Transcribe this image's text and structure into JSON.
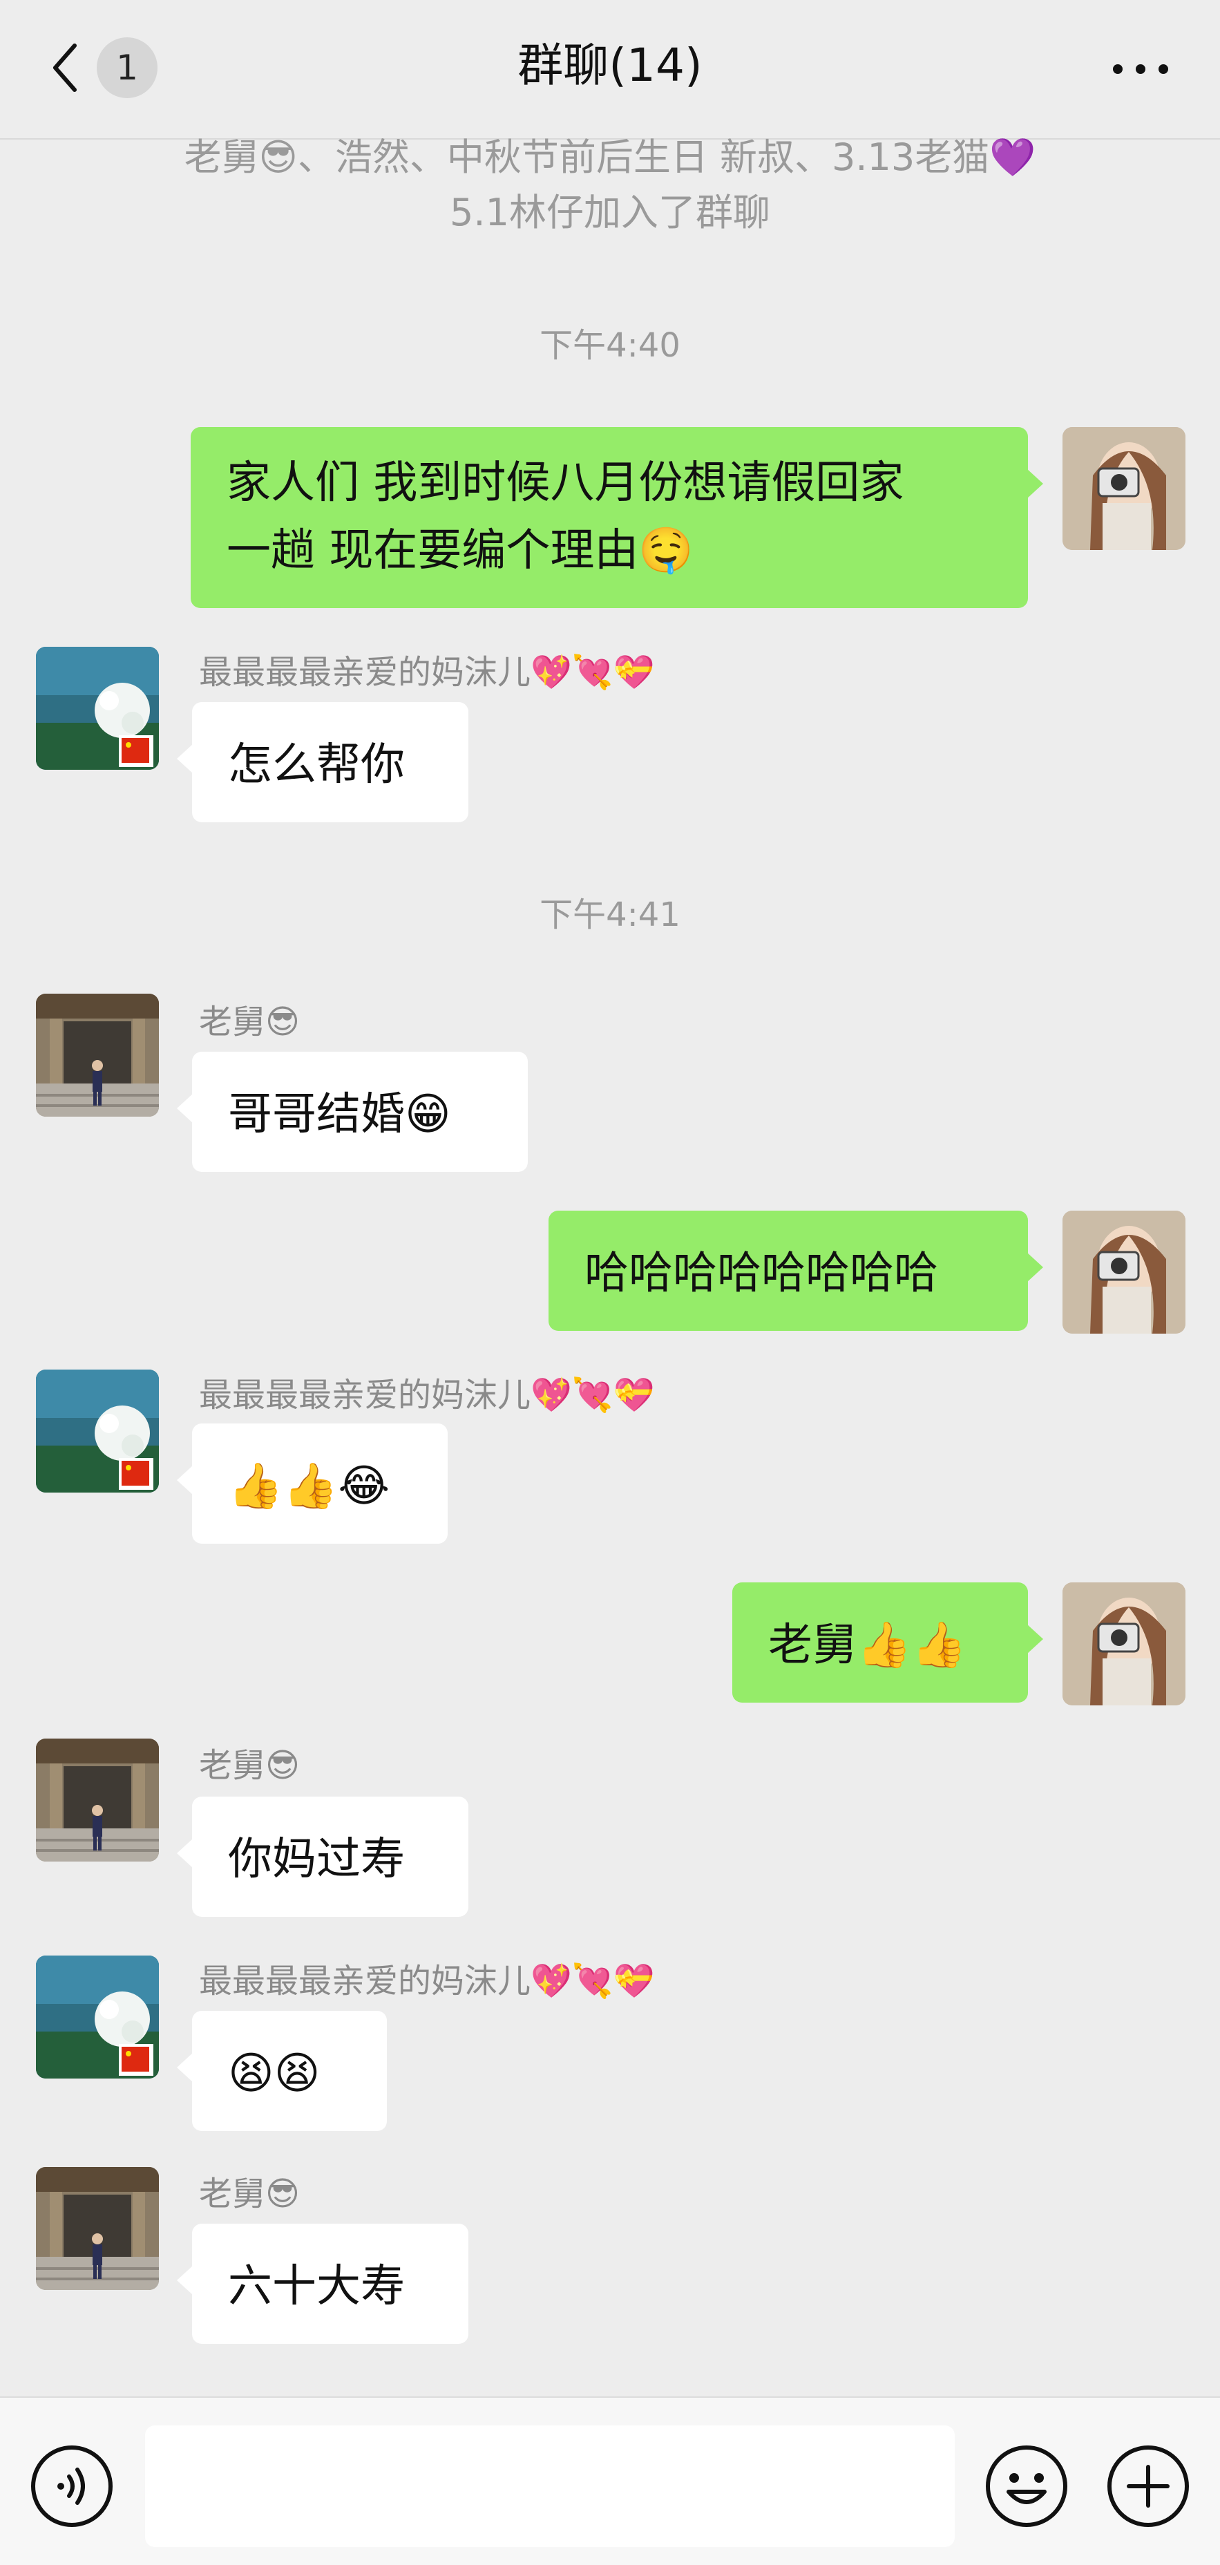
{
  "header": {
    "back_count": "1",
    "title": "群聊(14)"
  },
  "system_notice": {
    "line1": "老舅😎、浩然、中秋节前后生日  新叔、3.13老猫💜",
    "line2": "5.1林仔加入了群聊"
  },
  "timestamps": [
    "下午4:40",
    "下午4:41"
  ],
  "contacts": {
    "mom": "最最最最亲爱的妈沫儿💖💘💝",
    "uncle": "老舅😎"
  },
  "messages": [
    {
      "side": "out",
      "text_line1": "家人们 我到时候八月份想请假回家",
      "text_line2": "一趟 现在要编个理由🤤"
    },
    {
      "side": "in",
      "sender": "mom",
      "text": "怎么帮你"
    },
    {
      "side": "in",
      "sender": "uncle",
      "text": "哥哥结婚😁"
    },
    {
      "side": "out",
      "text": "哈哈哈哈哈哈哈哈"
    },
    {
      "side": "in",
      "sender": "mom",
      "text": "👍👍😂"
    },
    {
      "side": "out",
      "text": "老舅👍👍"
    },
    {
      "side": "in",
      "sender": "uncle",
      "text": "你妈过寿"
    },
    {
      "side": "in",
      "sender": "mom",
      "text": "😫😫"
    },
    {
      "side": "in",
      "sender": "uncle",
      "text": "六十大寿"
    }
  ],
  "input": {
    "value": ""
  },
  "icons": {
    "back": "chevron-left-icon",
    "more": "more-dots-icon",
    "voice": "voice-icon",
    "emoji": "emoji-icon",
    "plus": "plus-icon"
  },
  "colors": {
    "background": "#ededed",
    "outgoing_bubble": "#95ec69",
    "incoming_bubble": "#ffffff"
  }
}
